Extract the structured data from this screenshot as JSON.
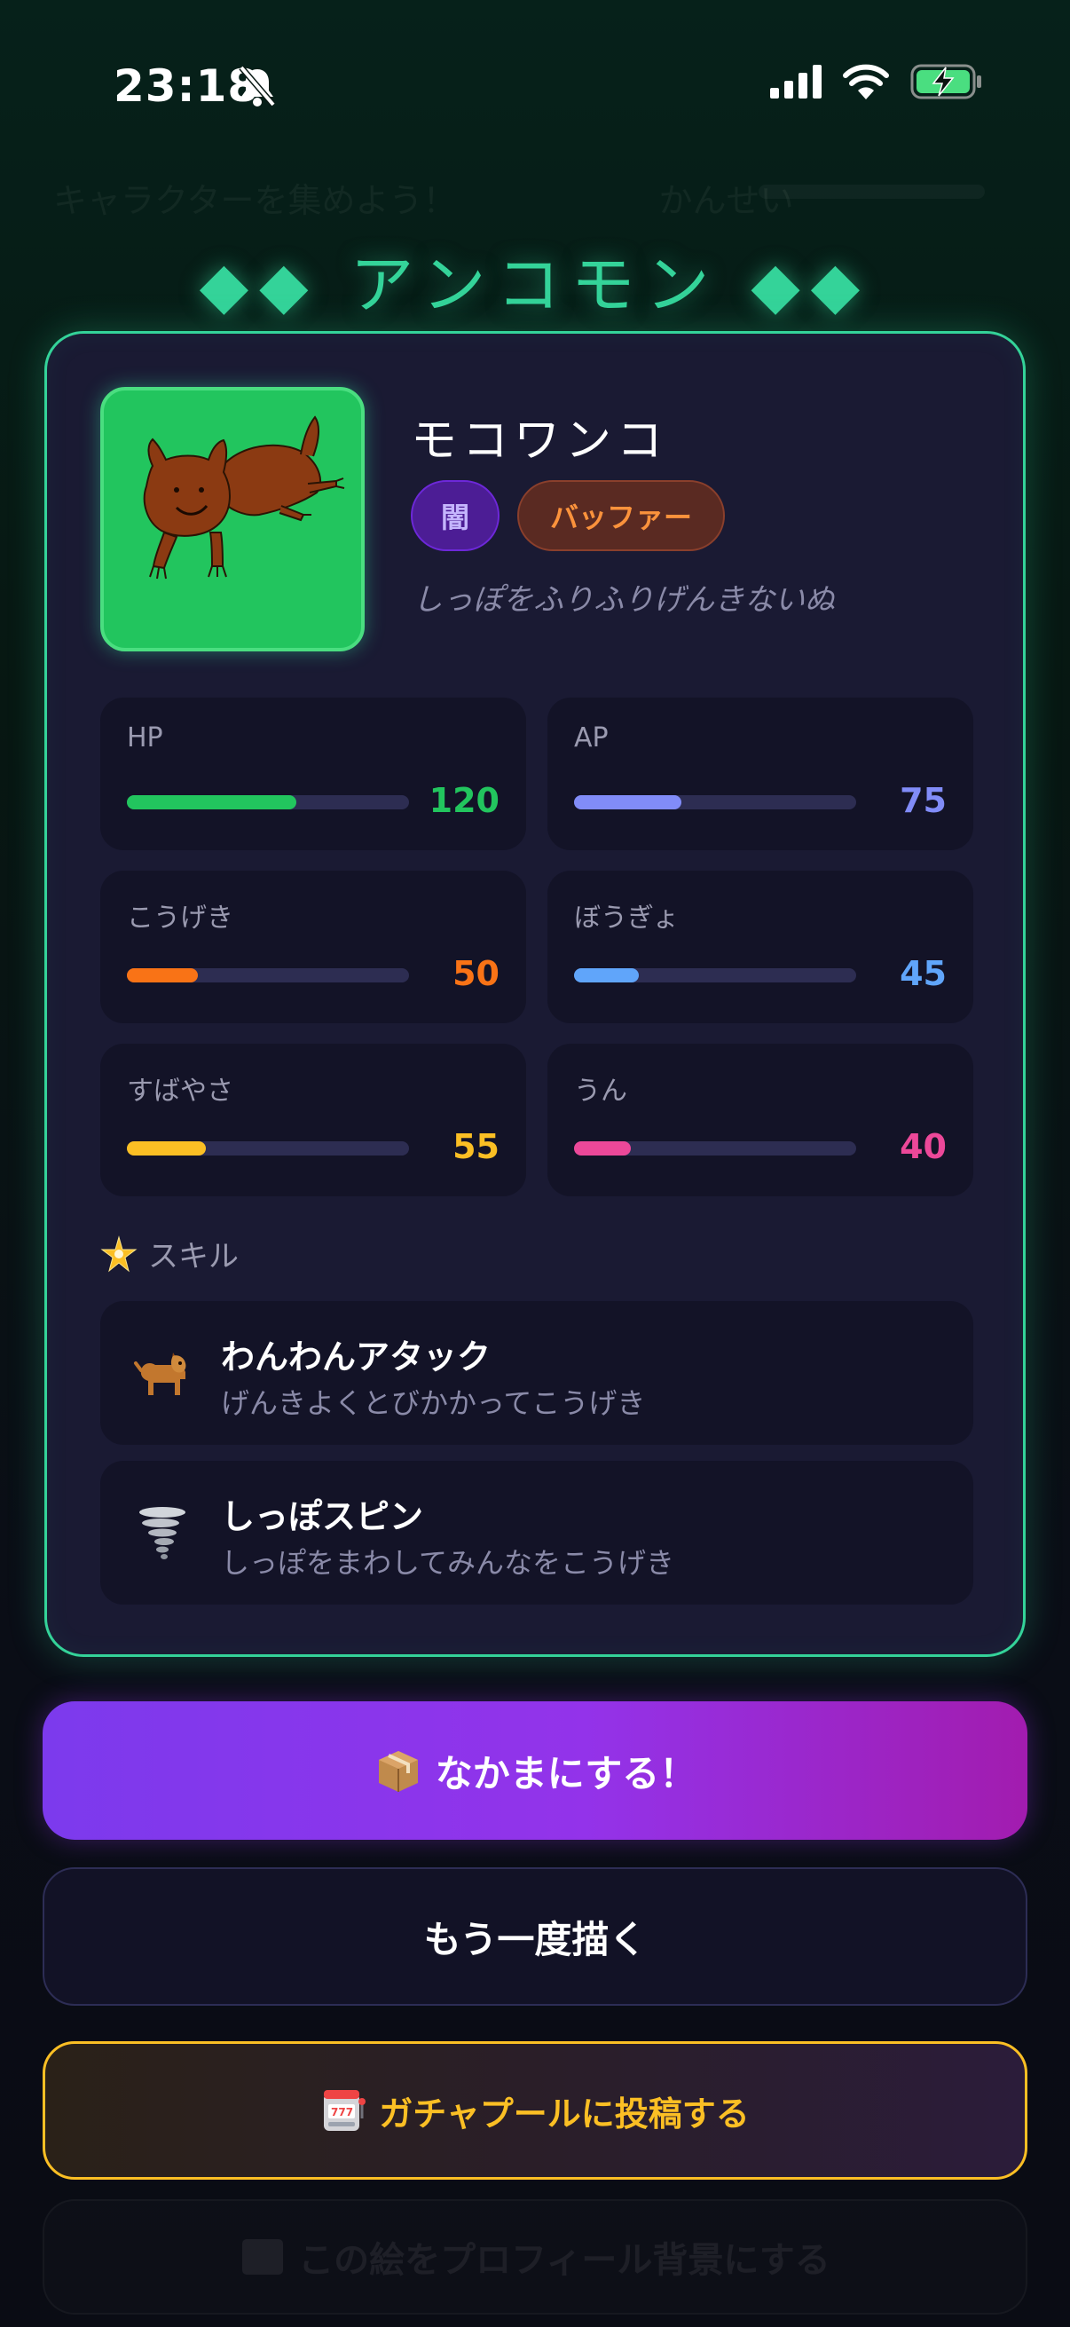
{
  "status_bar": {
    "time": "23:18"
  },
  "background": {
    "ghost_text": "キャラクターを集めよう！　　　　　　かんせい"
  },
  "rarity": {
    "label": "◆◆ アンコモン ◆◆",
    "color": "#34d399"
  },
  "character": {
    "name": "モコワンコ",
    "attribute": "闇",
    "role": "バッファー",
    "description": "しっぽをふりふりげんきないぬ",
    "portrait_icon": "brown-dog-drawing",
    "stats": [
      {
        "label": "HP",
        "value": "120",
        "fraction": 0.6,
        "color": "#22c55e"
      },
      {
        "label": "AP",
        "value": "75",
        "fraction": 0.38,
        "color": "#818cf8"
      },
      {
        "label": "こうげき",
        "value": "50",
        "fraction": 0.25,
        "color": "#f97316"
      },
      {
        "label": "ぼうぎょ",
        "value": "45",
        "fraction": 0.23,
        "color": "#60a5fa"
      },
      {
        "label": "すばやさ",
        "value": "55",
        "fraction": 0.28,
        "color": "#fbbf24"
      },
      {
        "label": "うん",
        "value": "40",
        "fraction": 0.2,
        "color": "#ec4899"
      }
    ],
    "skills_title": "スキル",
    "skills": [
      {
        "name": "わんわんアタック",
        "description": "げんきよくとびかかってこうげき",
        "icon": "dog-icon"
      },
      {
        "name": "しっぽスピン",
        "description": "しっぽをまわしてみんなをこうげき",
        "icon": "tornado-icon"
      }
    ]
  },
  "actions": {
    "recruit": "なかまにする！",
    "redraw": "もう一度描く",
    "gacha_post": "ガチャプールに投稿する",
    "profile_bg": "この絵をプロフィール背景にする"
  }
}
